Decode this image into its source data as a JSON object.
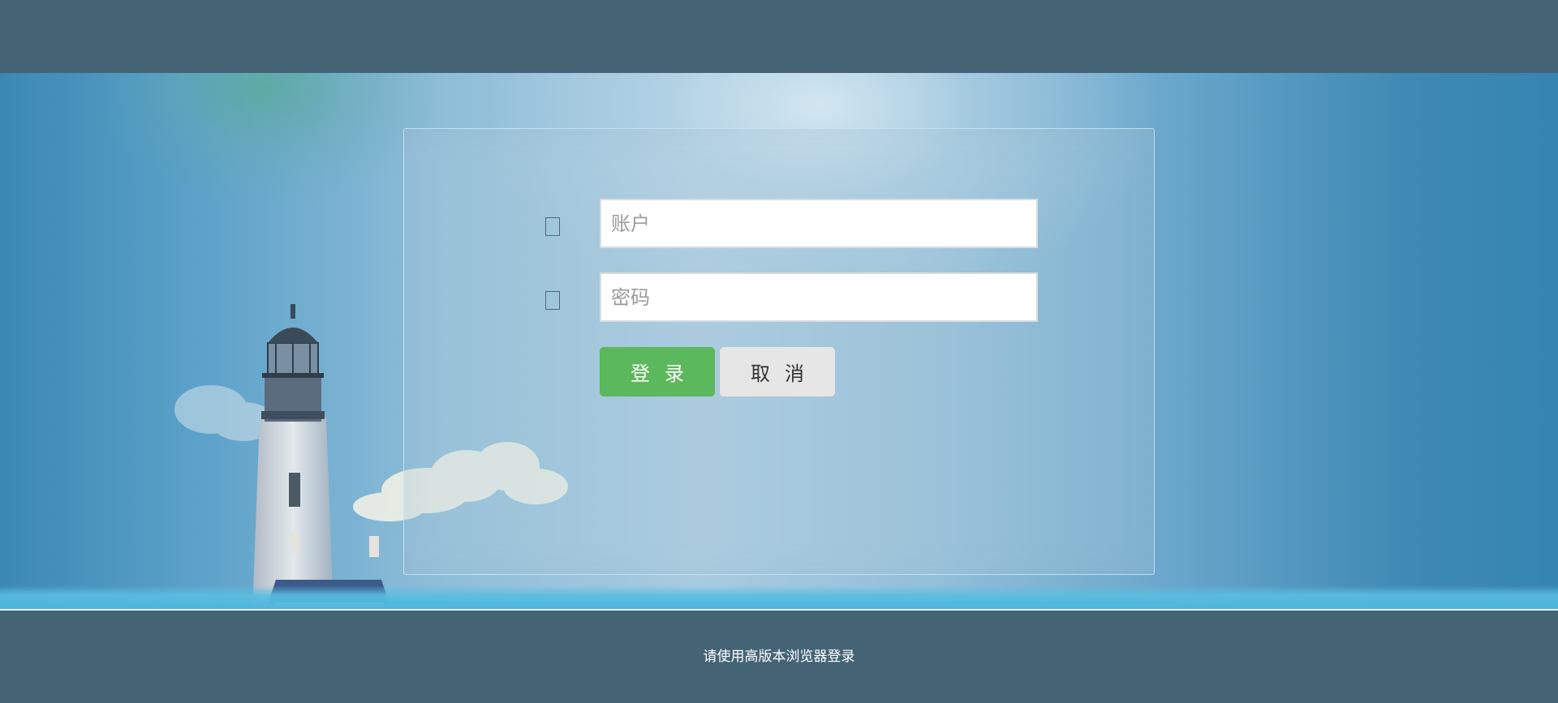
{
  "form": {
    "account": {
      "placeholder": "账户",
      "value": "",
      "icon": "user-icon"
    },
    "password": {
      "placeholder": "密码",
      "value": "",
      "icon": "lock-icon"
    },
    "login_label": "登录",
    "cancel_label": "取消"
  },
  "footer": {
    "notice": "请使用高版本浏览器登录"
  },
  "colors": {
    "header_footer_bg": "#446476",
    "login_button": "#5cb85c",
    "cancel_button": "#e6e6e6",
    "sky_blue": "#3a88b4"
  }
}
